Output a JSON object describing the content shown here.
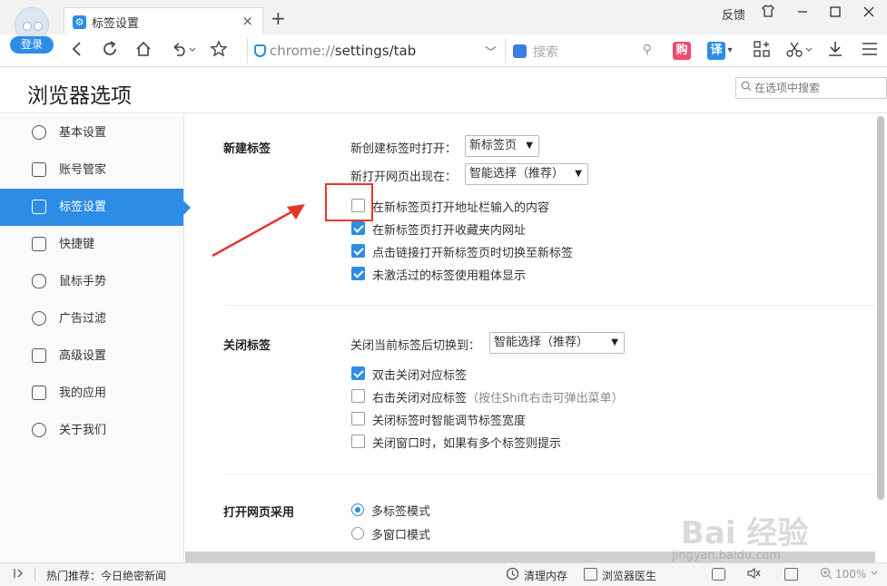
{
  "browser": {
    "login_label": "登录",
    "tab_title": "标签设置",
    "tab_close": "×",
    "new_tab": "+",
    "feedback": "反馈",
    "address_prefix": "chrome://",
    "address_path": "settings/tab",
    "search_placeholder": "搜索",
    "ext_buy": "购",
    "ext_translate": "译"
  },
  "header": {
    "title": "浏览器选项",
    "search_placeholder": "在选项中搜索"
  },
  "sidebar": {
    "items": [
      {
        "label": "基本设置"
      },
      {
        "label": "账号管家"
      },
      {
        "label": "标签设置"
      },
      {
        "label": "快捷键"
      },
      {
        "label": "鼠标手势"
      },
      {
        "label": "广告过滤"
      },
      {
        "label": "高级设置"
      },
      {
        "label": "我的应用"
      },
      {
        "label": "关于我们"
      }
    ],
    "active_index": 2
  },
  "new_tab": {
    "title": "新建标签",
    "open_label": "新创建标签时打开：",
    "open_value": "新标签页",
    "position_label": "新打开网页出现在：",
    "position_value": "智能选择（推荐）",
    "options": [
      {
        "label": "在新标签页打开地址栏输入的内容",
        "checked": false
      },
      {
        "label": "在新标签页打开收藏夹内网址",
        "checked": true
      },
      {
        "label": "点击链接打开新标签页时切换至新标签",
        "checked": true
      },
      {
        "label": "未激活过的标签使用粗体显示",
        "checked": true
      }
    ]
  },
  "close_tab": {
    "title": "关闭标签",
    "switch_label": "关闭当前标签后切换到：",
    "switch_value": "智能选择（推荐）",
    "options": [
      {
        "label": "双击关闭对应标签",
        "checked": true
      },
      {
        "label": "右击关闭对应标签",
        "hint": "（按住Shift右击可弹出菜单）",
        "checked": false
      },
      {
        "label": "关闭标签时智能调节标签宽度",
        "checked": false
      },
      {
        "label": "关闭窗口时，如果有多个标签则提示",
        "checked": false
      }
    ]
  },
  "open_mode": {
    "title": "打开网页采用",
    "options": [
      {
        "label": "多标签模式",
        "selected": true
      },
      {
        "label": "多窗口模式",
        "selected": false
      }
    ]
  },
  "statusbar": {
    "news": "热门推荐：今日绝密新闻",
    "clean_memory": "清理内存",
    "doctor": "浏览器医生",
    "zoom": "100%"
  },
  "watermark": {
    "brand": "Bai 经验",
    "url": "jingyan.baidu.com"
  },
  "colors": {
    "accent": "#2d8ce6",
    "annotation": "#e8352c"
  }
}
